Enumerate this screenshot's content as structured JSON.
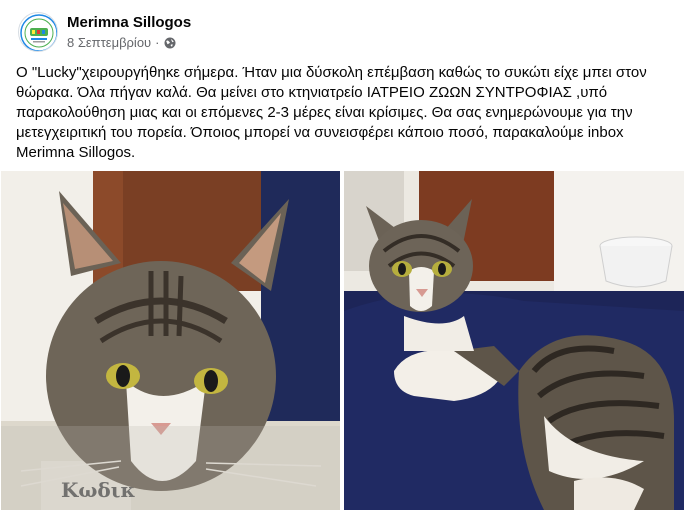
{
  "post": {
    "author": "Merimna Sillogos",
    "date": "8 Σεπτεμβρίου",
    "dot": "·",
    "text": "Ο \"Lucky\"χειρουργήθηκε σήμερα. Ήταν μια δύσκολη επέμβαση καθώς το συκώτι είχε μπει στον θώρακα. Όλα πήγαν καλά. Θα μείνει στο κτηνιατρείο ΙΑΤΡΕΙΟ ΖΩΩΝ ΣΥΝΤΡΟΦΙΑΣ ,υπό παρακολούθηση μιας και οι επόμενες 2-3 μέρες είναι κρίσιμες. Θα σας ενημερώνουμε για την μετεγχειριτική του πορεία. Όποιος μπορεί να συνεισφέρει κάποιο ποσό, παρακαλούμε inbox Merimna Sillogos.",
    "more_icon": "more-horizontal-icon",
    "audience_icon": "globe-icon",
    "more_label": "···",
    "photo_left_text": "Κωδικ",
    "colors": {
      "text": "#050505",
      "secondary": "#65676b",
      "avatar_green": "#4caf50",
      "avatar_blue": "#1e88e5"
    }
  }
}
